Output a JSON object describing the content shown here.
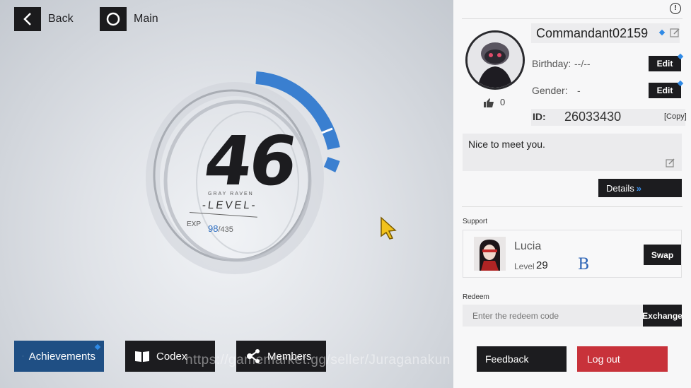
{
  "nav": {
    "back_label": "Back",
    "main_label": "Main"
  },
  "level": {
    "value": "46",
    "faction": "GRAY RAVEN",
    "word": "-LEVEL-",
    "exp_label": "EXP",
    "exp_current": "98",
    "exp_max": "/435",
    "exp_fraction": 0.225
  },
  "bottom_buttons": {
    "achievements": "Achievements",
    "codex": "Codex",
    "members": "Members"
  },
  "watermark": "https://gamemarket.gg/seller/Juraganakun",
  "profile": {
    "name": "Commandant02159",
    "likes": "0",
    "birthday_label": "Birthday:",
    "birthday_value": "--/--",
    "gender_label": "Gender:",
    "gender_value": "-",
    "edit_label": "Edit",
    "id_label": "ID:",
    "id_value": "26033430",
    "copy_label": "[Copy]",
    "bio": "Nice to meet you.",
    "details_label": "Details"
  },
  "support": {
    "section_label": "Support",
    "name": "Lucia",
    "level_label": "Level",
    "level_value": "29",
    "rank": "B",
    "swap_label": "Swap"
  },
  "redeem": {
    "section_label": "Redeem",
    "placeholder": "Enter the redeem code",
    "exchange_label": "Exchange"
  },
  "footer": {
    "feedback_label": "Feedback",
    "logout_label": "Log out"
  },
  "colors": {
    "accent_blue": "#3a7fd0",
    "logout_red": "#c8323a",
    "button_dark": "#1c1c1f",
    "badge_blue": "#2f8ae6"
  }
}
